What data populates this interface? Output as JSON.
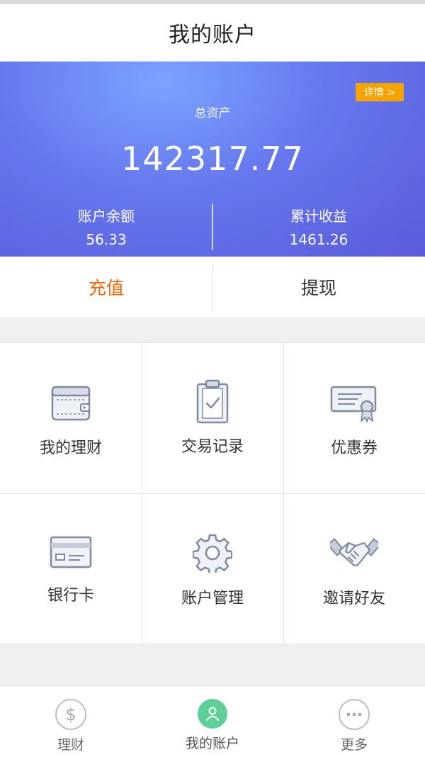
{
  "header": {
    "title": "我的账户"
  },
  "banner": {
    "detail_button": "详情 >",
    "total_label": "总资产",
    "total_value": "142317.77",
    "balance_label": "账户余额",
    "balance_value": "56.33",
    "income_label": "累计收益",
    "income_value": "1461.26"
  },
  "actions": {
    "recharge": "充值",
    "withdraw": "提现"
  },
  "grid": {
    "items": [
      {
        "label": "我的理财",
        "icon": "wallet-icon"
      },
      {
        "label": "交易记录",
        "icon": "clipboard-icon"
      },
      {
        "label": "优惠券",
        "icon": "certificate-icon"
      },
      {
        "label": "银行卡",
        "icon": "bank-card-icon"
      },
      {
        "label": "账户管理",
        "icon": "gear-icon"
      },
      {
        "label": "邀请好友",
        "icon": "handshake-icon"
      }
    ]
  },
  "tabbar": {
    "tabs": [
      {
        "label": "理财",
        "icon": "dollar-icon",
        "active": false
      },
      {
        "label": "我的账户",
        "icon": "user-icon",
        "active": true
      },
      {
        "label": "更多",
        "icon": "more-icon",
        "active": false
      }
    ]
  },
  "colors": {
    "accent_orange": "#e8690e",
    "detail_badge": "#f5a300",
    "banner_blue": "#6677ee",
    "active_tab": "#5fcf9a",
    "icon_stroke": "#7f8a9e"
  }
}
